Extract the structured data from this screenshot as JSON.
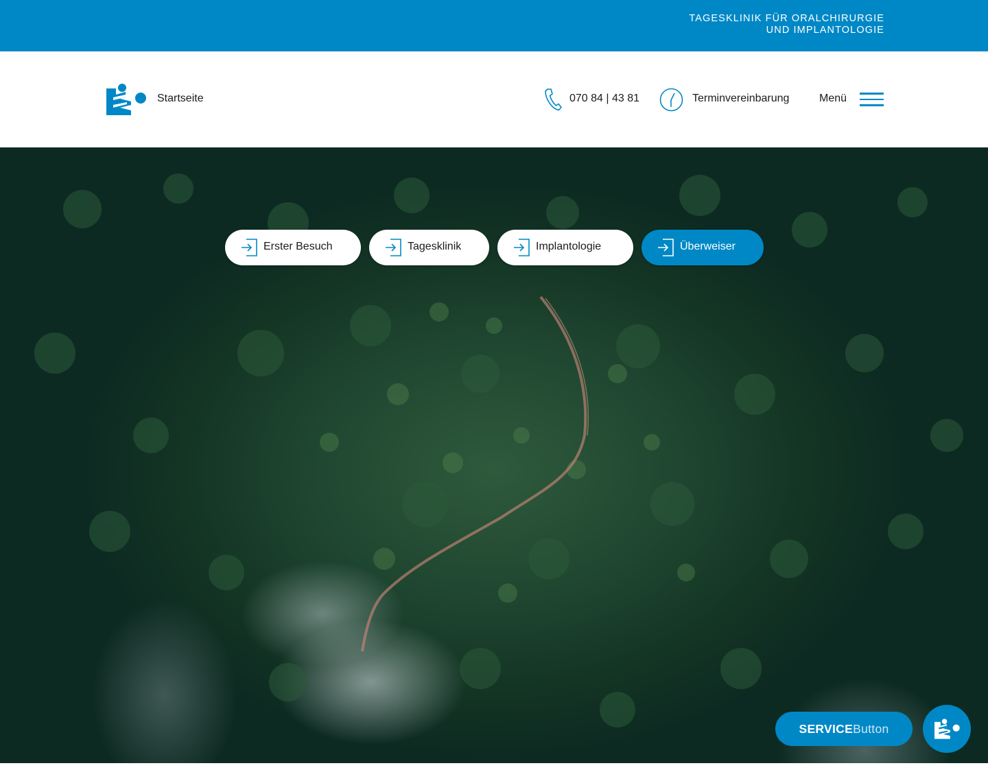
{
  "topbar": {
    "tagline_line1": "TAGESKLINIK FÜR ORALCHIRURGIE",
    "tagline_line2": "UND IMPLANTOLOGIE"
  },
  "header": {
    "logo_icon": "clinic-logo-icon",
    "home_label": "Startseite",
    "phone_icon": "phone-icon",
    "phone_number": "070 84 | 43 81",
    "appointment_icon": "clock-icon",
    "appointment_label": "Terminvereinbarung",
    "menu_label": "Menü",
    "menu_icon": "hamburger-icon"
  },
  "hero": {
    "background": "aerial forest photo with winding road and mist",
    "nav_pills": [
      {
        "label": "Erster Besuch",
        "icon": "login-arrow-icon",
        "active": false
      },
      {
        "label": "Tagesklinik",
        "icon": "login-arrow-icon",
        "active": false
      },
      {
        "label": "Implantologie",
        "icon": "login-arrow-icon",
        "active": false
      },
      {
        "label": "Überweiser",
        "icon": "login-arrow-icon",
        "active": true
      }
    ]
  },
  "service": {
    "label_strong": "SERVICE",
    "label_light": "Button",
    "circle_icon": "clinic-logo-icon"
  },
  "colors": {
    "brand_blue": "#0088c6",
    "text": "#1b1b1b",
    "white": "#ffffff"
  }
}
